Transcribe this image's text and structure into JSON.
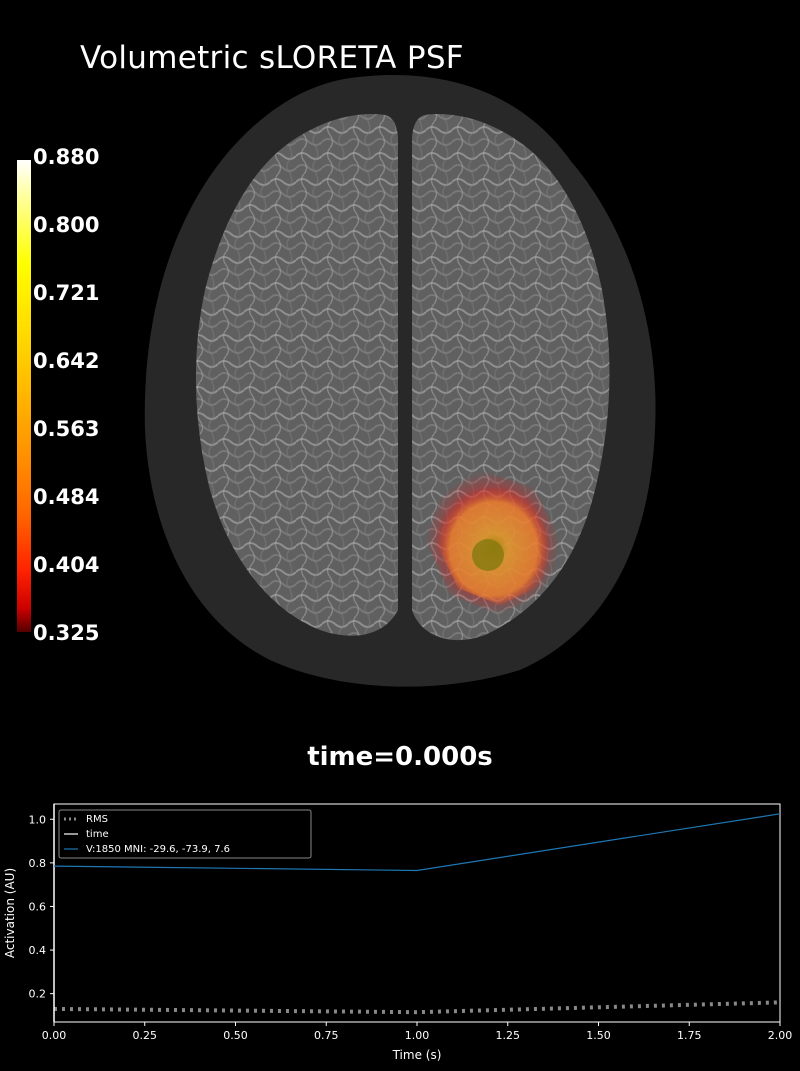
{
  "title": "Volumetric sLORETA PSF",
  "colorbar": {
    "labels": [
      "0.880",
      "0.800",
      "0.721",
      "0.642",
      "0.563",
      "0.484",
      "0.404",
      "0.325"
    ],
    "min": 0.325,
    "max": 0.88,
    "colormap": "hot"
  },
  "time_label": "time=0.000s",
  "chart_data": {
    "type": "line",
    "xlabel": "Time (s)",
    "ylabel": "Activation (AU)",
    "xlim": [
      0,
      2
    ],
    "ylim": [
      0.07,
      1.07
    ],
    "x_ticks": [
      "0.00",
      "0.25",
      "0.50",
      "0.75",
      "1.00",
      "1.25",
      "1.50",
      "1.75",
      "2.00"
    ],
    "y_ticks": [
      "0.2",
      "0.4",
      "0.6",
      "0.8",
      "1.0"
    ],
    "legend_position": "top-left",
    "series": [
      {
        "name": "RMS",
        "x": [
          0,
          1,
          2
        ],
        "values": [
          0.13,
          0.115,
          0.16
        ],
        "color": "#888888",
        "style": "dotted"
      },
      {
        "name": "time",
        "x": [
          0,
          0
        ],
        "values": [
          0.07,
          1.07
        ],
        "color": "#ffffff",
        "style": "solid"
      },
      {
        "name": "V:1850   MNI: -29.6, -73.9,   7.6",
        "x": [
          0,
          1,
          2
        ],
        "values": [
          0.785,
          0.765,
          1.025
        ],
        "color": "#1f77b4",
        "style": "solid"
      }
    ]
  }
}
